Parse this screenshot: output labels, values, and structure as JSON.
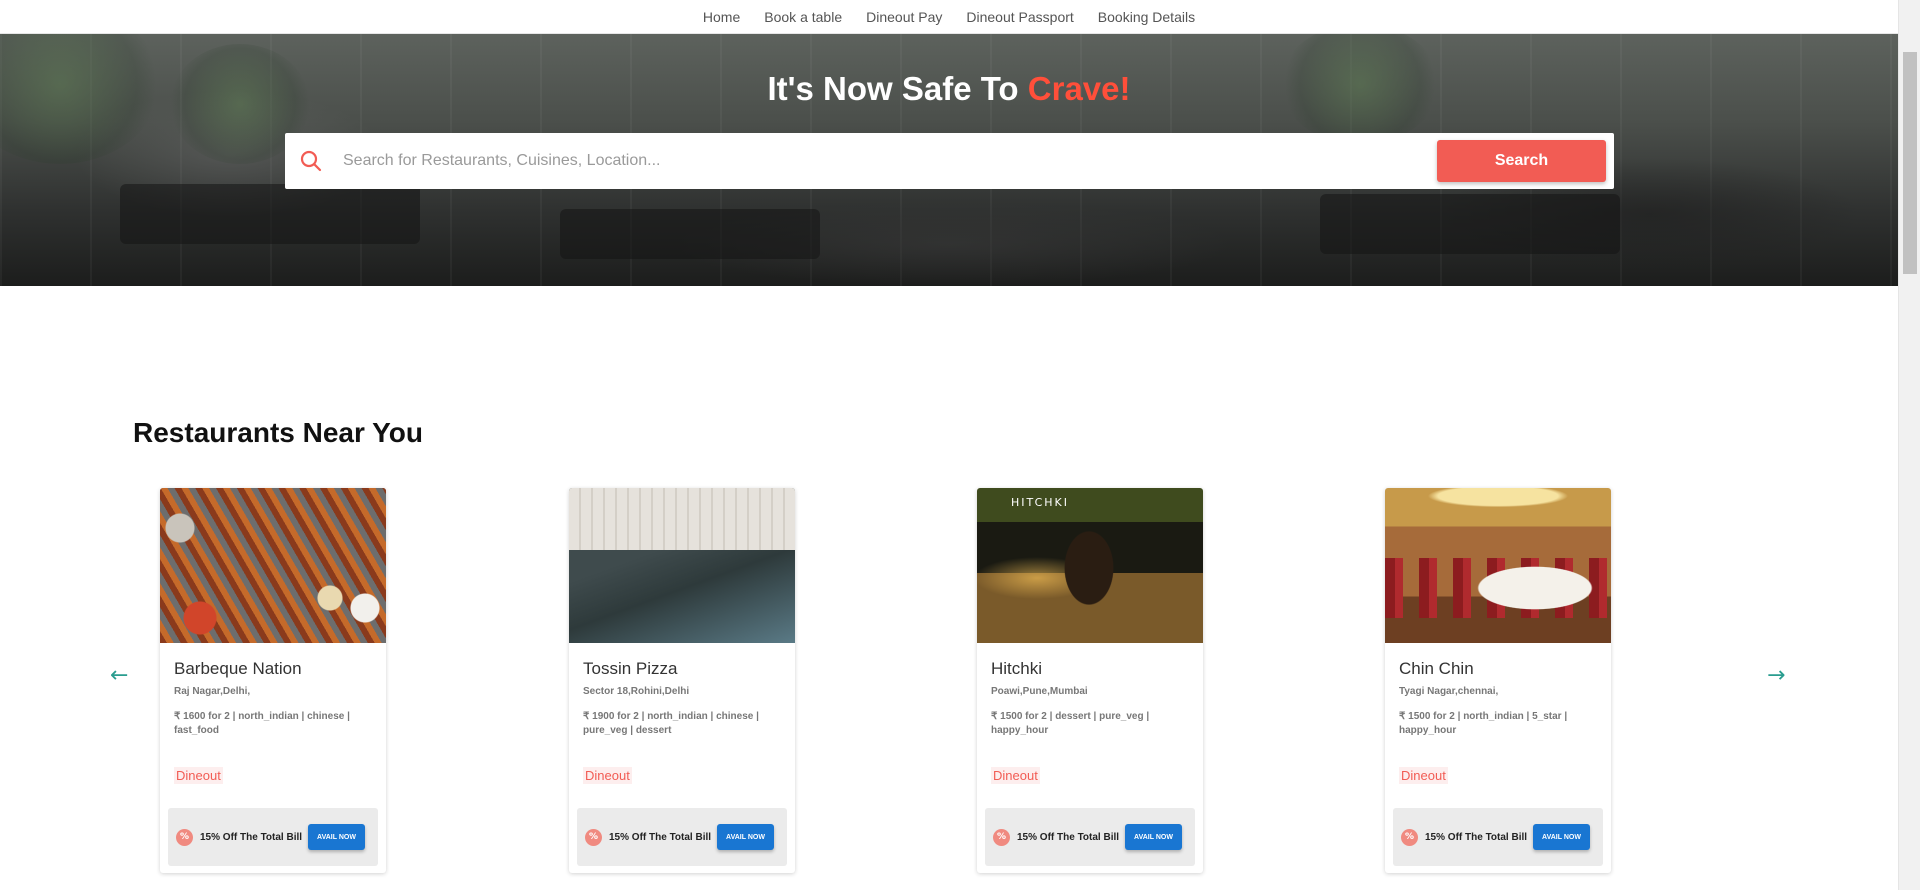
{
  "nav": {
    "items": [
      "Home",
      "Book a table",
      "Dineout Pay",
      "Dineout Passport",
      "Booking Details"
    ]
  },
  "hero": {
    "title_prefix": "It's Now Safe To ",
    "title_accent": "Crave!",
    "search_placeholder": "Search for Restaurants, Cuisines, Location...",
    "search_button": "Search"
  },
  "section": {
    "title": "Restaurants Near You",
    "prev_arrow": "←",
    "next_arrow": "→"
  },
  "restaurants": [
    {
      "name": "Barbeque Nation",
      "location": "Raj Nagar,Delhi,",
      "meta": "₹ 1600 for 2 | north_indian | chinese | fast_food",
      "tag": "Dineout",
      "offer": "15% Off The Total Bill",
      "offer_badge": "%",
      "cta": "AVAIL NOW"
    },
    {
      "name": "Tossin Pizza",
      "location": "Sector 18,Rohini,Delhi",
      "meta": "₹ 1900 for 2 | north_indian | chinese | pure_veg | dessert",
      "tag": "Dineout",
      "offer": "15% Off The Total Bill",
      "offer_badge": "%",
      "cta": "AVAIL NOW"
    },
    {
      "name": "Hitchki",
      "location": "Poawi,Pune,Mumbai",
      "meta": "₹ 1500 for 2 | dessert | pure_veg | happy_hour",
      "tag": "Dineout",
      "offer": "15% Off The Total Bill",
      "offer_badge": "%",
      "cta": "AVAIL NOW",
      "image_sign": "HITCHKI"
    },
    {
      "name": "Chin Chin",
      "location": "Tyagi Nagar,chennai,",
      "meta": "₹ 1500 for 2 | north_indian | 5_star | happy_hour",
      "tag": "Dineout",
      "offer": "15% Off The Total Bill",
      "offer_badge": "%",
      "cta": "AVAIL NOW"
    }
  ],
  "colors": {
    "accent": "#f25c54",
    "hero_accent": "#ff4f3a",
    "cta_blue": "#1976d2",
    "arrow": "#2a9d8f"
  },
  "icons": {
    "search": "search-icon",
    "prev": "arrow-left-icon",
    "next": "arrow-right-icon",
    "offer": "discount-icon"
  }
}
